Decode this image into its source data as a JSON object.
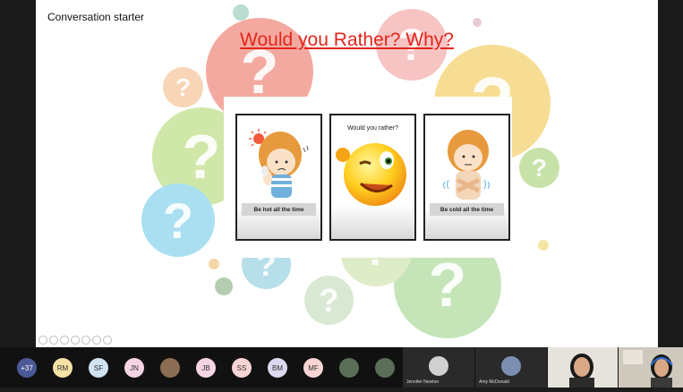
{
  "slide": {
    "label": "Conversation starter",
    "title": "Would you Rather? Why?",
    "cards": [
      {
        "caption": "Be hot all the time"
      },
      {
        "top_text": "Would you rather?"
      },
      {
        "caption": "Be cold all the time"
      }
    ]
  },
  "participants": {
    "more_count": "+37",
    "initials": [
      "RM",
      "SF",
      "JN",
      "JB",
      "SS",
      "BM",
      "MF"
    ],
    "video_tiles": [
      "Jennifer Newton",
      "Amy McDonald"
    ]
  }
}
